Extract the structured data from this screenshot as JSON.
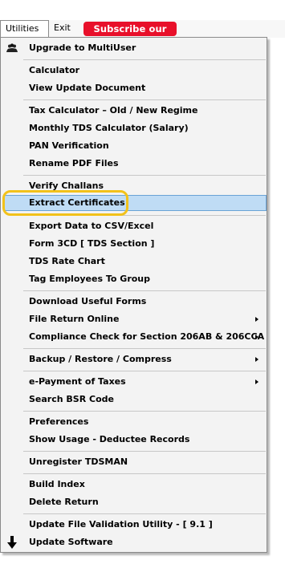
{
  "menubar": {
    "utilities_label": "Utilities",
    "exit_label": "Exit",
    "subscribe_label": "Subscribe our Blog"
  },
  "menu": {
    "upgrade": "Upgrade to MultiUser",
    "calculator": "Calculator",
    "view_update_document": "View Update Document",
    "tax_calculator": "Tax Calculator – Old / New Regime",
    "monthly_tds_calculator": "Monthly TDS Calculator (Salary)",
    "pan_verification": "PAN Verification",
    "rename_pdf_files": "Rename PDF Files",
    "verify_challans": "Verify Challans",
    "extract_certificates": "Extract Certificates",
    "export_data": "Export Data to CSV/Excel",
    "form_3cd": "Form 3CD [ TDS Section ]",
    "tds_rate_chart": "TDS Rate Chart",
    "tag_employees": "Tag Employees To Group",
    "download_forms": "Download Useful Forms",
    "file_return_online": "File Return Online",
    "compliance_check": "Compliance Check for Section 206AB & 206CCA",
    "backup_restore": "Backup / Restore / Compress",
    "e_payment": "e-Payment of Taxes",
    "search_bsr": "Search BSR Code",
    "preferences": "Preferences",
    "show_usage": "Show Usage - Deductee Records",
    "unregister": "Unregister TDSMAN",
    "build_index": "Build Index",
    "delete_return": "Delete Return",
    "update_validation": "Update File Validation Utility - [ 9.1 ]",
    "update_software": "Update Software"
  },
  "highlighted_item": "extract_certificates",
  "colors": {
    "subscribe_bg": "#e8102a",
    "highlight_bg": "#bfdcf5",
    "highlight_ring": "#f2c21b"
  },
  "icons": {
    "upgrade": "users-icon",
    "update_software": "down-arrow-icon",
    "submenu": "submenu-arrow-icon"
  }
}
